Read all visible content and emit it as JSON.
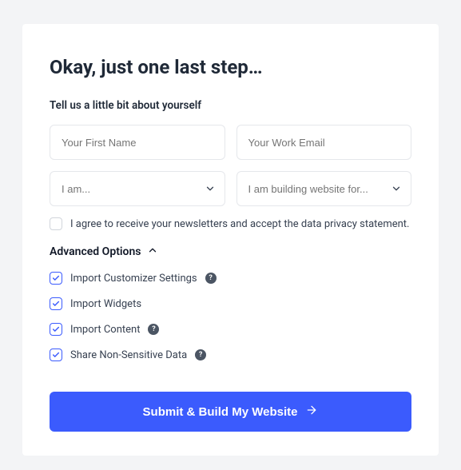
{
  "title": "Okay, just one last step…",
  "subtitle": "Tell us a little bit about yourself",
  "firstNamePlaceholder": "Your First Name",
  "emailPlaceholder": "Your Work Email",
  "iAmPlaceholder": "I am...",
  "buildingForPlaceholder": "I am building website for...",
  "consentText": "I agree to receive your newsletters and accept the data privacy statement.",
  "consentChecked": false,
  "advancedLabel": "Advanced Options",
  "options": [
    {
      "label": "Import Customizer Settings",
      "checked": true,
      "info": true
    },
    {
      "label": "Import Widgets",
      "checked": true,
      "info": false
    },
    {
      "label": "Import Content",
      "checked": true,
      "info": true
    },
    {
      "label": "Share Non-Sensitive Data",
      "checked": true,
      "info": true
    }
  ],
  "submitLabel": "Submit & Build My Website"
}
